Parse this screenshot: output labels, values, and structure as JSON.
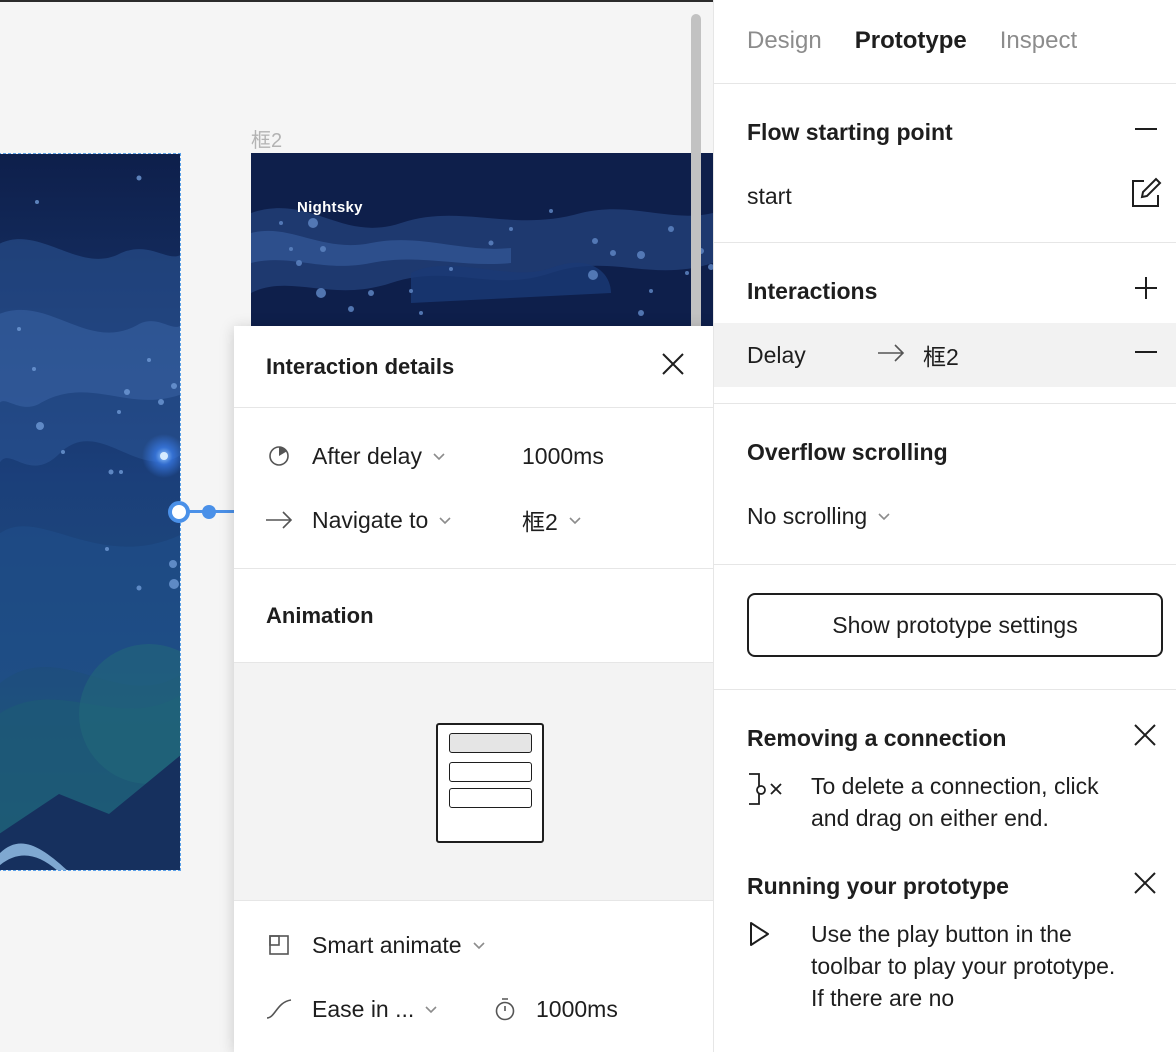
{
  "canvas": {
    "frame2_label": "框2",
    "frame2_brand": "Nightsky"
  },
  "details": {
    "title": "Interaction details",
    "trigger": {
      "label": "After delay",
      "value": "1000ms"
    },
    "action": {
      "label": "Navigate to",
      "destination": "框2"
    },
    "animation_heading": "Animation",
    "animation_type": "Smart animate",
    "easing": "Ease in ...",
    "duration": "1000ms"
  },
  "panel": {
    "tabs": [
      "Design",
      "Prototype",
      "Inspect"
    ],
    "active_tab": "Prototype",
    "flow": {
      "heading": "Flow starting point",
      "name": "start"
    },
    "interactions": {
      "heading": "Interactions",
      "trigger": "Delay",
      "destination": "框2"
    },
    "overflow": {
      "heading": "Overflow scrolling",
      "value": "No scrolling"
    },
    "settings_button": "Show prototype settings",
    "tips": [
      {
        "heading": "Removing a connection",
        "body": "To delete a connection, click and drag on either end."
      },
      {
        "heading": "Running your prototype",
        "body": "Use the play button in the toolbar to play your prototype. If there are no"
      }
    ]
  },
  "colors": {
    "accent": "#4a90e8",
    "sky_dark": "#0e1f4b",
    "sky_mid": "#1e4a8a",
    "teal": "#1f5f6e"
  }
}
